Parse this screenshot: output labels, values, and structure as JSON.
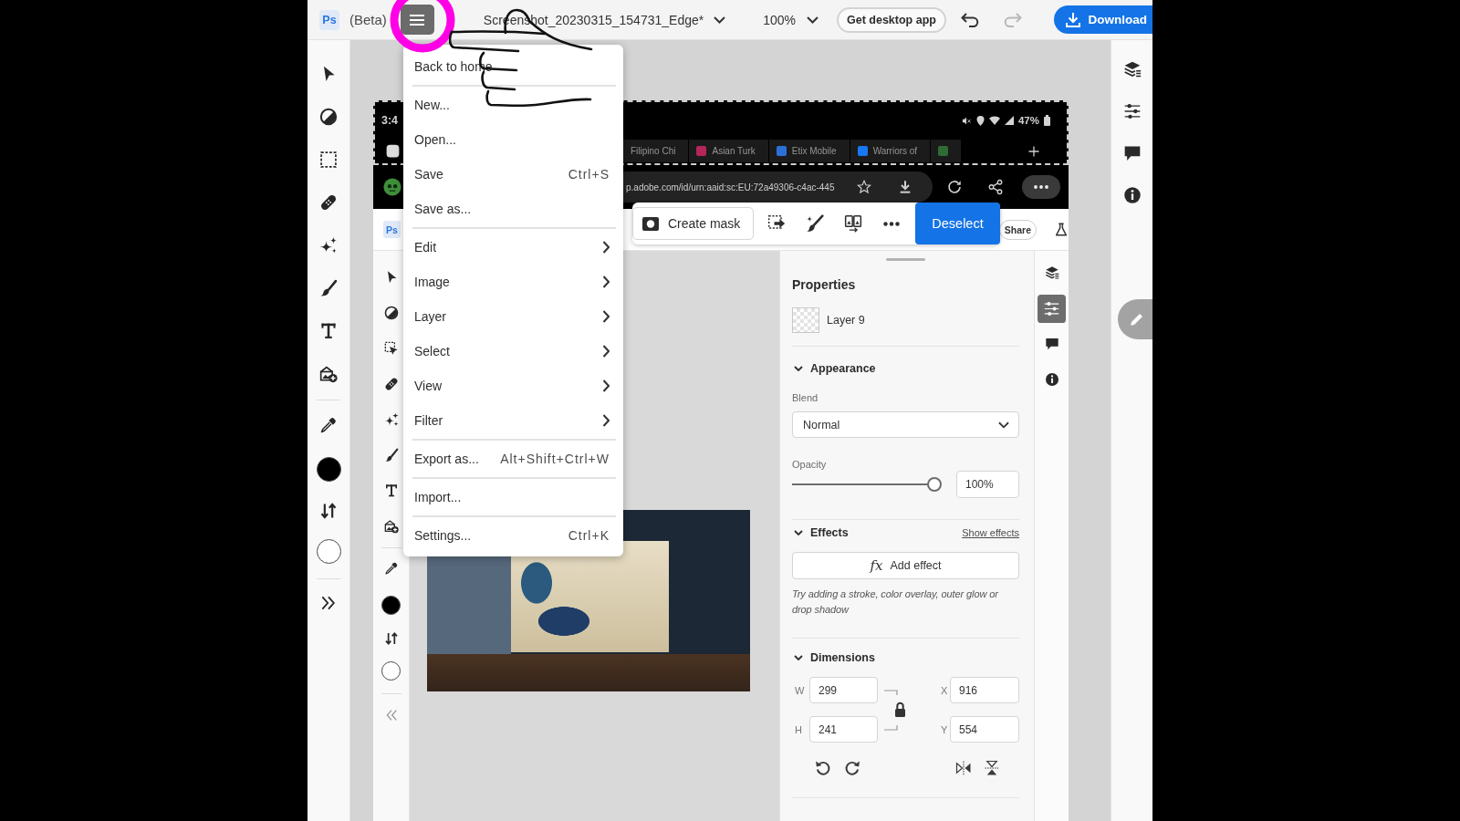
{
  "top_bar": {
    "logo": "Ps",
    "beta_tag": "(Beta)",
    "menu_button": {
      "pressed": true,
      "circled": true
    },
    "document_title": "Screenshot_20230315_154731_Edge*",
    "zoom": "100%",
    "desktop_app_button": "Get desktop app",
    "history_buttons": [
      {
        "kind": "undo",
        "disabled": false
      },
      {
        "kind": "redo",
        "disabled": true
      }
    ],
    "download_button": "Download"
  },
  "toolbar": [
    {
      "kind": "select"
    },
    {
      "kind": "adjust"
    },
    {
      "kind": "marquee"
    },
    {
      "kind": "heal"
    },
    {
      "kind": "magic"
    },
    {
      "kind": "brush"
    },
    {
      "kind": "text"
    },
    {
      "kind": "add-image"
    },
    {
      "kind": "divider"
    },
    {
      "kind": "eyedropper"
    },
    {
      "kind": "swatch",
      "color": "#000000"
    },
    {
      "kind": "swap"
    },
    {
      "kind": "swatch",
      "color": "#ffffff"
    },
    {
      "kind": "divider"
    },
    {
      "kind": "expand"
    }
  ],
  "main_menu": {
    "groups": [
      {
        "items": [
          {
            "label": "Back to home",
            "submenu": false
          }
        ]
      },
      {
        "items": [
          {
            "label": "New...",
            "submenu": false
          },
          {
            "label": "Open...",
            "submenu": false
          },
          {
            "label": "Save",
            "shortcut": "Ctrl+S",
            "submenu": false
          },
          {
            "label": "Save as...",
            "submenu": false
          }
        ]
      },
      {
        "items": [
          {
            "label": "Edit",
            "submenu": true
          },
          {
            "label": "Image",
            "submenu": true
          },
          {
            "label": "Layer",
            "submenu": true
          },
          {
            "label": "Select",
            "submenu": true
          },
          {
            "label": "View",
            "submenu": true
          },
          {
            "label": "Filter",
            "submenu": true
          }
        ]
      },
      {
        "items": [
          {
            "label": "Export as...",
            "shortcut": "Alt+Shift+Ctrl+W",
            "submenu": false
          }
        ]
      },
      {
        "items": [
          {
            "label": "Import...",
            "submenu": false
          }
        ]
      },
      {
        "items": [
          {
            "label": "Settings...",
            "shortcut": "Ctrl+K",
            "submenu": false
          }
        ]
      }
    ]
  },
  "canvas_image": {
    "status_bar": {
      "time": "3:4",
      "battery": "47%"
    },
    "browser_tabs": [
      {
        "title": "Filipino Chi"
      },
      {
        "title": "Asian Turk",
        "color": "#b3265a"
      },
      {
        "title": "Etix Mobile",
        "color": "#2d6fd8"
      },
      {
        "title": "Warriors of",
        "color": "#1877f2"
      },
      {
        "color": "#2f6b35"
      }
    ],
    "address_bar": "p.adobe.com/id/urn:aaid:sc:EU:72a49306-c4ac-445",
    "app": {
      "logo": "Ps",
      "share_button": "Share",
      "quick_actions": {
        "create_mask": "Create mask",
        "deselect": "Deselect"
      },
      "toolbar": [
        {
          "kind": "select"
        },
        {
          "kind": "adjust"
        },
        {
          "kind": "object-select"
        },
        {
          "kind": "heal"
        },
        {
          "kind": "magic"
        },
        {
          "kind": "brush"
        },
        {
          "kind": "text"
        },
        {
          "kind": "add-image"
        },
        {
          "kind": "divider"
        },
        {
          "kind": "eyedropper"
        },
        {
          "kind": "swatch",
          "color": "#000000"
        },
        {
          "kind": "swap"
        },
        {
          "kind": "swatch",
          "color": "#ffffff"
        },
        {
          "kind": "divider"
        },
        {
          "kind": "collapse"
        }
      ],
      "properties": {
        "title": "Properties",
        "layer_name": "Layer 9",
        "appearance": {
          "heading": "Appearance",
          "expanded": true,
          "blend_label": "Blend",
          "blend_mode": "Normal",
          "opacity_label": "Opacity",
          "opacity": {
            "level": 1
          },
          "opacity_value": "100%"
        },
        "effects": {
          "heading": "Effects",
          "expanded": true,
          "show_link": "Show effects",
          "add_icon": "fx",
          "add_button": "Add effect",
          "hint": "Try adding a stroke, color overlay, outer glow or drop shadow"
        },
        "dimensions": {
          "heading": "Dimensions",
          "expanded": true,
          "fields": [
            {
              "label": "W",
              "value": "299"
            },
            {
              "label": "X",
              "value": "916"
            },
            {
              "label": "H",
              "value": "241"
            },
            {
              "label": "Y",
              "value": "554"
            }
          ],
          "aspect_locked": true
        }
      },
      "panel_tabs": [
        {
          "kind": "layers",
          "selected": false
        },
        {
          "kind": "properties",
          "selected": true
        },
        {
          "kind": "comments",
          "selected": false
        },
        {
          "kind": "info",
          "selected": false
        }
      ]
    }
  },
  "side_panel_tabs": [
    {
      "kind": "layers",
      "selected": false
    },
    {
      "kind": "properties",
      "selected": false
    },
    {
      "kind": "comments",
      "selected": false
    },
    {
      "kind": "info",
      "selected": false
    }
  ]
}
